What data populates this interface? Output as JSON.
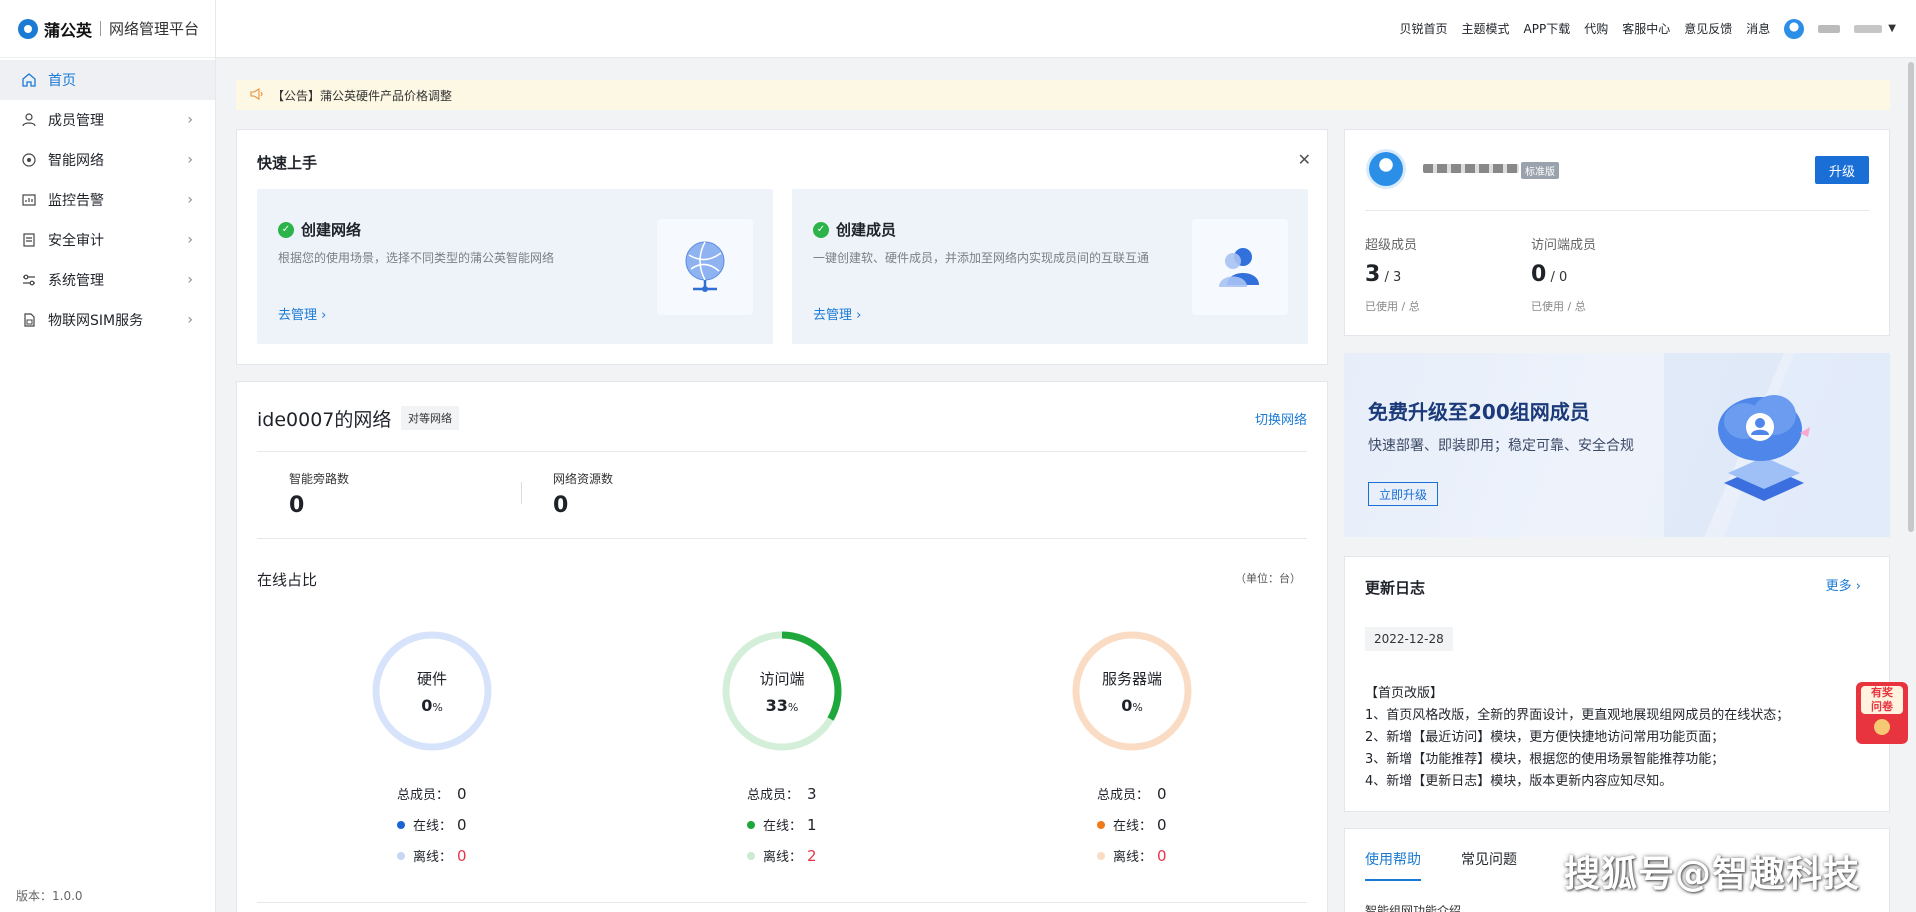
{
  "logo": {
    "brand": "蒲公英",
    "subtitle": "网络管理平台"
  },
  "sidebar": {
    "items": [
      {
        "label": "首页",
        "icon": "home-icon"
      },
      {
        "label": "成员管理",
        "icon": "user-icon"
      },
      {
        "label": "智能网络",
        "icon": "network-icon"
      },
      {
        "label": "监控告警",
        "icon": "monitor-icon"
      },
      {
        "label": "安全审计",
        "icon": "audit-icon"
      },
      {
        "label": "系统管理",
        "icon": "settings-icon"
      },
      {
        "label": "物联网SIM服务",
        "icon": "sim-icon"
      }
    ],
    "version": "版本：1.0.0"
  },
  "header": {
    "links": [
      "贝锐首页",
      "主题模式",
      "APP下载",
      "代购",
      "客服中心",
      "意见反馈",
      "消息"
    ]
  },
  "notice": {
    "text": "【公告】蒲公英硬件产品价格调整"
  },
  "quickstart": {
    "title": "快速上手",
    "tiles": [
      {
        "title": "创建网络",
        "desc": "根据您的使用场景，选择不同类型的蒲公英智能网络",
        "link": "去管理"
      },
      {
        "title": "创建成员",
        "desc": "一键创建软、硬件成员，并添加至网络内实现成员间的互联互通",
        "link": "去管理"
      }
    ]
  },
  "network": {
    "title": "ide0007的网络",
    "tag": "对等网络",
    "switch": "切换网络",
    "stats": [
      {
        "label": "智能旁路数",
        "value": "0"
      },
      {
        "label": "网络资源数",
        "value": "0"
      }
    ],
    "online_title": "在线占比",
    "unit": "（单位：台）",
    "rings": [
      {
        "name": "硬件",
        "pct": "0",
        "total": "0",
        "online": "0",
        "offline": "0",
        "color": "#1a64d6",
        "track": "#d6e3fb",
        "offdot": "#c7d6f5",
        "fraction": 0
      },
      {
        "name": "访问端",
        "pct": "33",
        "total": "3",
        "online": "1",
        "offline": "2",
        "color": "#1ea73a",
        "track": "#d4efd9",
        "offdot": "#c9ecd0",
        "fraction": 0.333
      },
      {
        "name": "服务器端",
        "pct": "0",
        "total": "0",
        "online": "0",
        "offline": "0",
        "color": "#f07a1a",
        "track": "#fadcc4",
        "offdot": "#f9dcc2",
        "fraction": 0
      }
    ],
    "legend": {
      "total": "总成员：",
      "online": "在线：",
      "offline": "离线："
    },
    "percent_sign": "%"
  },
  "account": {
    "badge": "标准版",
    "upgrade": "升级",
    "blocks": [
      {
        "label": "超级成员",
        "used": "3",
        "total": "3",
        "sub": "已使用 / 总"
      },
      {
        "label": "访问端成员",
        "used": "0",
        "total": "0",
        "sub": "已使用 / 总"
      }
    ]
  },
  "promo": {
    "title": "免费升级至200组网成员",
    "sub": "快速部署、即装即用；稳定可靠、安全合规",
    "button": "立即升级"
  },
  "changelog": {
    "title": "更新日志",
    "more": "更多",
    "date": "2022-12-28",
    "heading": "【首页改版】",
    "lines": [
      "1、首页风格改版，全新的界面设计，更直观地展现组网成员的在线状态；",
      "2、新增【最近访问】模块，更方便快捷地访问常用功能页面；",
      "3、新增【功能推荐】模块，根据您的使用场景智能推荐功能；",
      "4、新增【更新日志】模块，版本更新内容应知尽知。"
    ]
  },
  "help": {
    "tabs": [
      "使用帮助",
      "常见问题"
    ],
    "first_item": "智能组网功能介绍"
  },
  "survey": {
    "line1": "有奖",
    "line2": "问卷"
  },
  "watermark": "搜狐号@智趣科技"
}
